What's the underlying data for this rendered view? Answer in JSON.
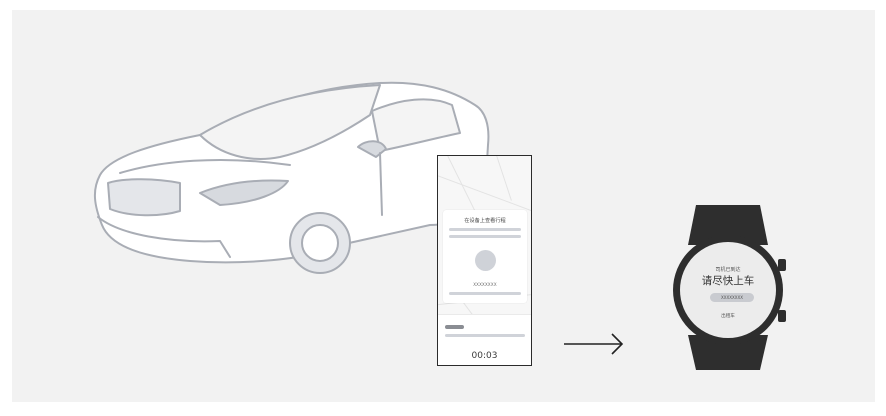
{
  "phone": {
    "card_title": "在设备上查看行程",
    "plate": "XXXXXXXX",
    "timer": "00:03"
  },
  "watch": {
    "status": "司机已到达",
    "message": "请尽快上车",
    "plate": "XXXXXXXX",
    "vehicle": "出租车"
  },
  "icons": {
    "car": "car-illustration",
    "arrow": "right-arrow-icon"
  },
  "colors": {
    "background": "#f2f2f2",
    "car_body": "#a9adb5",
    "watch_body": "#2e2e2e",
    "watch_face": "#ececec"
  }
}
